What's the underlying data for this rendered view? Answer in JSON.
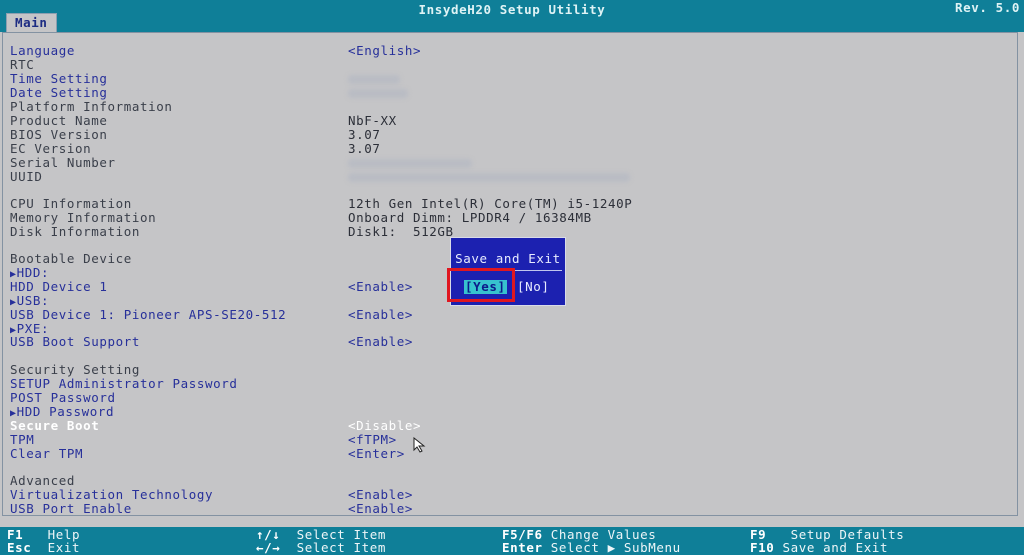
{
  "header": {
    "title": "InsydeH20 Setup Utility",
    "revision": "Rev. 5.0"
  },
  "tabs": {
    "main": "Main"
  },
  "rows": {
    "language": {
      "label": "Language",
      "value": "<English>"
    },
    "rtc": {
      "label": "RTC"
    },
    "time": {
      "label": "Time Setting"
    },
    "date": {
      "label": "Date Setting"
    },
    "platform": {
      "label": "Platform Information"
    },
    "product": {
      "label": "Product Name",
      "value": "NbF-XX"
    },
    "bios": {
      "label": "BIOS Version",
      "value": "3.07"
    },
    "ec": {
      "label": "EC Version",
      "value": "3.07"
    },
    "serial": {
      "label": "Serial Number"
    },
    "uuid": {
      "label": "UUID"
    },
    "cpu": {
      "label": "CPU Information",
      "value": "12th Gen Intel(R) Core(TM) i5-1240P"
    },
    "memory": {
      "label": "Memory Information",
      "value": "Onboard Dimm: LPDDR4 / 16384MB"
    },
    "disk": {
      "label": "Disk Information",
      "value": "Disk1:  512GB"
    },
    "bootable": {
      "label": "Bootable Device"
    },
    "hdd": {
      "label": "HDD:"
    },
    "hdd_device": {
      "label": "HDD Device 1",
      "value": "<Enable>"
    },
    "usb": {
      "label": "USB:"
    },
    "usb_device": {
      "label": "USB Device 1: Pioneer APS-SE20-512",
      "value": "<Enable>"
    },
    "pxe": {
      "label": "PXE:"
    },
    "usb_boot": {
      "label": "USB Boot Support",
      "value": "<Enable>"
    },
    "security": {
      "label": "Security Setting"
    },
    "admin_pw": {
      "label": "SETUP Administrator Password"
    },
    "post_pw": {
      "label": "POST Password"
    },
    "hdd_pw": {
      "label": "HDD Password"
    },
    "secure_boot": {
      "label": "Secure Boot",
      "value": "<Disable>"
    },
    "tpm": {
      "label": "TPM",
      "value": "<fTPM>"
    },
    "clear_tpm": {
      "label": "Clear TPM",
      "value": "<Enter>"
    },
    "advanced": {
      "label": "Advanced"
    },
    "virtualization": {
      "label": "Virtualization Technology",
      "value": "<Enable>"
    },
    "usb_port": {
      "label": "USB Port Enable",
      "value": "<Enable>"
    }
  },
  "dialog": {
    "title": "Save and Exit",
    "yes": "[Yes]",
    "no": "[No]"
  },
  "footer": {
    "f1_key": "F1",
    "f1_text": "Help",
    "esc_key": "Esc",
    "esc_text": "Exit",
    "updown_key": "↑/↓",
    "updown_text": "Select Item",
    "leftright_key": "←/→",
    "leftright_text": "Select Item",
    "f5f6_key": "F5/F6",
    "f5f6_text": "Change Values",
    "enter_key": "Enter",
    "enter_text": "Select ▶ SubMenu",
    "f9_key": "F9",
    "f9_text": "Setup Defaults",
    "f10_key": "F10",
    "f10_text": "Save and Exit"
  },
  "icons": {
    "submenu_marker": "triangle-right-icon",
    "pointer": "mouse-pointer-icon"
  },
  "colors": {
    "accent": "#0f7f98",
    "dialog": "#1c21b0",
    "highlight": "#e01720",
    "background": "#c5c5c7",
    "text": "#27309a"
  }
}
